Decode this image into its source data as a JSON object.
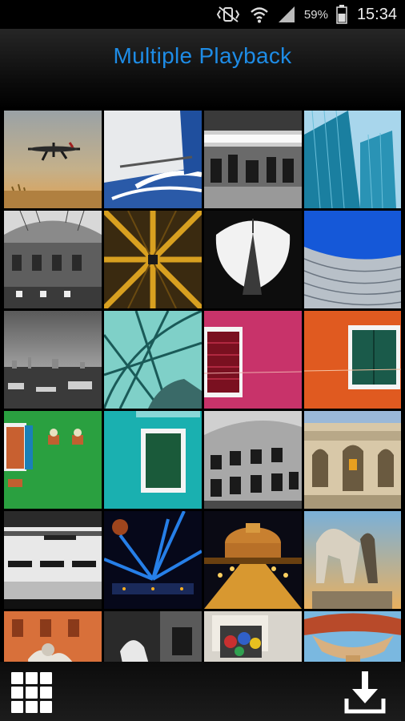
{
  "status": {
    "battery": "59%",
    "time": "15:34",
    "icons": [
      "mute-vibrate-icon",
      "wifi-icon",
      "signal-icon",
      "battery-icon"
    ]
  },
  "header": {
    "title": "Multiple Playback"
  },
  "theme": {
    "accent": "#1e8ce6"
  },
  "photos": [
    {
      "subject": "airplane-landing"
    },
    {
      "subject": "airplane-tail"
    },
    {
      "subject": "market-stalls"
    },
    {
      "subject": "glass-skyscraper"
    },
    {
      "subject": "galleria-arcade"
    },
    {
      "subject": "abstract-tower-star"
    },
    {
      "subject": "tower-through-opening"
    },
    {
      "subject": "curved-facade-blue-sky"
    },
    {
      "subject": "city-skyline"
    },
    {
      "subject": "glass-canopy"
    },
    {
      "subject": "pink-wall-window"
    },
    {
      "subject": "orange-wall-window"
    },
    {
      "subject": "green-house-flowerpots"
    },
    {
      "subject": "teal-wall-window"
    },
    {
      "subject": "colosseum"
    },
    {
      "subject": "baroque-fountain"
    },
    {
      "subject": "metro-station"
    },
    {
      "subject": "light-show-stage"
    },
    {
      "subject": "castel-sant-angelo-night"
    },
    {
      "subject": "horse-statue"
    },
    {
      "subject": "orange-building-statue"
    },
    {
      "subject": "black-white-statue"
    },
    {
      "subject": "painted-tiles-wall"
    },
    {
      "subject": "ornate-fountain-top"
    }
  ],
  "bottom": {
    "left_icon": "grid-view-icon",
    "right_icon": "download-icon"
  }
}
